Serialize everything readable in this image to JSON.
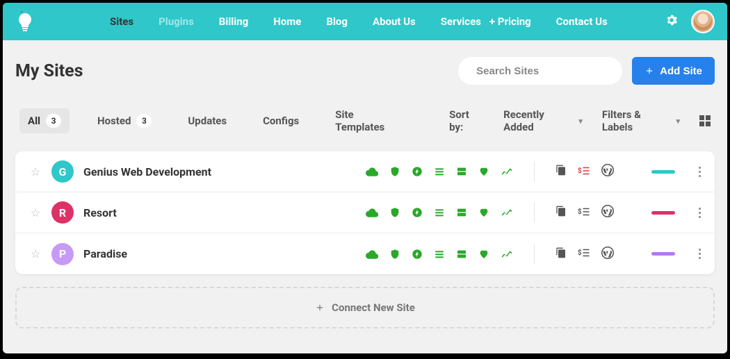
{
  "topnav": {
    "items": [
      {
        "label": "Sites",
        "state": "active"
      },
      {
        "label": "Plugins",
        "state": "muted"
      },
      {
        "label": "Billing",
        "state": ""
      },
      {
        "label": "Home",
        "state": ""
      },
      {
        "label": "Blog",
        "state": ""
      },
      {
        "label": "About Us",
        "state": ""
      },
      {
        "label": "Services",
        "state": ""
      }
    ],
    "pricing_label": "+ Pricing",
    "contact_label": "Contact Us"
  },
  "header": {
    "title": "My Sites",
    "search_placeholder": "Search Sites",
    "add_button": "Add Site"
  },
  "tabs": {
    "all": {
      "label": "All",
      "count": "3"
    },
    "hosted": {
      "label": "Hosted",
      "count": "3"
    },
    "updates": {
      "label": "Updates"
    },
    "configs": {
      "label": "Configs"
    },
    "templates": {
      "label": "Site Templates"
    },
    "sort_label": "Sort by:",
    "sort_value": "Recently Added",
    "filters_label": "Filters & Labels"
  },
  "sites": [
    {
      "letter": "G",
      "name": "Genius Web Development",
      "badge_color": "#2fc7c9",
      "dash_color": "#2fc7c9",
      "price_red": true
    },
    {
      "letter": "R",
      "name": "Resort",
      "badge_color": "#dd3267",
      "dash_color": "#dd3267",
      "price_red": false
    },
    {
      "letter": "P",
      "name": "Paradise",
      "badge_color": "#c79af5",
      "dash_color": "#b47af0",
      "price_red": false
    }
  ],
  "connect": {
    "label": "Connect New Site"
  }
}
